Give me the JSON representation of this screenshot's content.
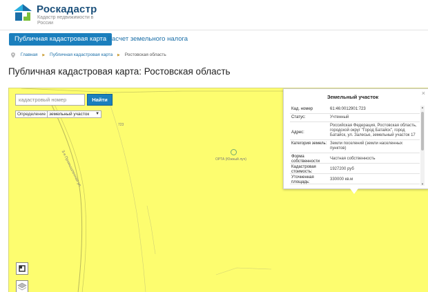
{
  "brand": {
    "name": "Роскадастр",
    "subtitle": "Кадастр недвижимости в России",
    "logo_colors": [
      "#1b6fa8",
      "#7cbf3a",
      "#2bb0e0"
    ]
  },
  "nav": {
    "tabs": [
      {
        "label": "Публичная кадастровая карта",
        "active": true
      },
      {
        "label": "Расчет земельного налога",
        "active": false
      }
    ]
  },
  "breadcrumb": {
    "items": [
      "Главная",
      "Публичная кадастровая карта",
      "Ростовская область"
    ]
  },
  "page_title": "Публичная кадастровая карта: Ростовская область",
  "map": {
    "background": "#fdfd6f",
    "search": {
      "placeholder": "кадастровый номер",
      "value": ""
    },
    "find_button_label": "Найти",
    "define": {
      "label": "Определение",
      "selected": "земельный участок"
    },
    "labels": {
      "parcel_number": "723",
      "street": "3-я Промышленная ул.",
      "poi": "ОРТА (Южный луч)"
    }
  },
  "popup": {
    "title": "Земельный участок",
    "close_symbol": "×",
    "properties": [
      {
        "key": "Кад. номер",
        "value": "61:46:0012901:723"
      },
      {
        "key": "Статус:",
        "value": "Учтенный"
      },
      {
        "key": "Адрес:",
        "value": "Российская Федерация, Ростовская область, городской округ \"Город Батайск\", город Батайск, ул. Залесье, земельный участок 17"
      },
      {
        "key": "Категория земель:",
        "value": "Земли поселений (земли населенных пунктов)"
      },
      {
        "key": "Форма собственности",
        "value": "Частная собственность"
      },
      {
        "key": "Кадастровая стоимость:",
        "value": "1927200 руб"
      },
      {
        "key": "Уточненная площадь:",
        "value": "330000 кв.м"
      }
    ]
  },
  "icons": {
    "logo": "rosreestr-logo-icon",
    "pin": "map-pin-icon",
    "fullscreen": "fullscreen-icon",
    "layers": "layers-icon",
    "poi": "poi-circle-icon"
  }
}
